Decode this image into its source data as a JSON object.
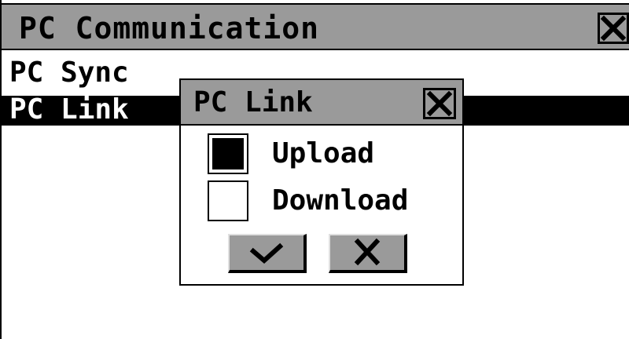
{
  "window": {
    "title": "PC Communication",
    "close_icon": "close-icon"
  },
  "list": {
    "items": [
      {
        "label": "PC Sync",
        "selected": false
      },
      {
        "label": "PC Link",
        "selected": true
      }
    ]
  },
  "dialog": {
    "title": "PC Link",
    "close_icon": "close-icon",
    "options": [
      {
        "label": "Upload",
        "checked": true
      },
      {
        "label": "Download",
        "checked": false
      }
    ],
    "buttons": {
      "ok_icon": "checkmark-icon",
      "cancel_icon": "close-icon"
    }
  },
  "colors": {
    "titlebar": "#9a9a9a",
    "selection": "#000000",
    "background": "#ffffff"
  }
}
